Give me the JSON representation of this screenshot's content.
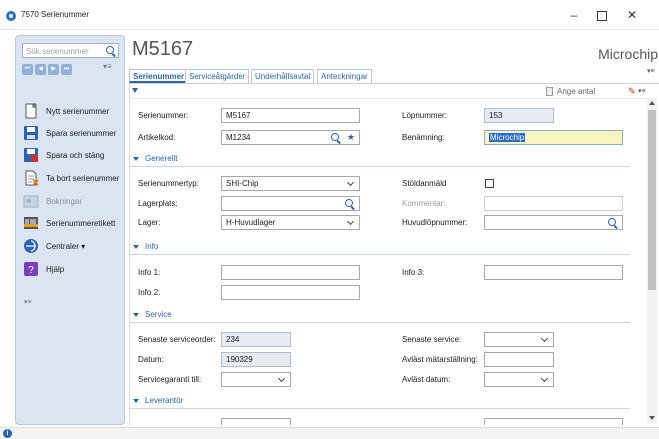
{
  "window": {
    "title": "7570 Serienummer",
    "min_glyph": "–",
    "close_glyph": "✕"
  },
  "sidebar": {
    "search_placeholder": "Sök serienummer",
    "nav_buttons": [
      "⏮",
      "◀",
      "▶",
      "⏭"
    ],
    "menu_glyph": "▾≡",
    "items": [
      {
        "label": "Nytt serienummer",
        "icon": "new-document-icon",
        "enabled": true
      },
      {
        "label": "Spara serienummer",
        "icon": "save-icon",
        "enabled": true
      },
      {
        "label": "Spara och stäng",
        "icon": "save-close-icon",
        "enabled": true
      },
      {
        "label": "Ta bort serienummer",
        "icon": "delete-document-icon",
        "enabled": true
      },
      {
        "label": "Bokningar",
        "icon": "bookings-icon",
        "enabled": false
      },
      {
        "label": "Serienummeretikett",
        "icon": "label-icon",
        "enabled": true
      },
      {
        "label": "Centraler",
        "icon": "centrals-icon",
        "enabled": true,
        "has_dropdown": true,
        "dropdown_glyph": "▾"
      },
      {
        "label": "Hjälp",
        "icon": "help-icon",
        "enabled": true
      }
    ],
    "bottom_menu_glyph": "▾≡"
  },
  "header": {
    "record_id": "M5167",
    "record_name": "Microchip"
  },
  "tabs": [
    {
      "label": "Serienummer",
      "active": true
    },
    {
      "label": "Serviceåtgärder",
      "active": false
    },
    {
      "label": "Underhållsavtal",
      "active": false
    },
    {
      "label": "Anteckningar",
      "active": false
    }
  ],
  "tabs_menu_glyph": "▾≡",
  "toolbar": {
    "ange_antal": "Ange antal",
    "flag_glyph": "✎",
    "menu_glyph": "▾≡"
  },
  "form": {
    "serienummer": {
      "label": "Serienummer:",
      "value": "M5167"
    },
    "lopnummer": {
      "label": "Löpnummer:",
      "value": "153"
    },
    "artikelkod": {
      "label": "Artikelkod:",
      "value": "M1234",
      "star": "★"
    },
    "benamning": {
      "label": "Benämning:",
      "value": "Microchip"
    },
    "sections": {
      "generellt": "Generellt",
      "info": "Info",
      "service": "Service",
      "leverantor": "Leverantör"
    },
    "serienummertyp": {
      "label": "Serienummertyp:",
      "value": "SHI-Chip"
    },
    "stoldanmald": {
      "label": "Stöldanmäld",
      "checked": false
    },
    "lagerplats": {
      "label": "Lagerplats:",
      "value": ""
    },
    "kommentar": {
      "label": "Kommentar:",
      "value": ""
    },
    "lager": {
      "label": "Lager:",
      "value": "H-Huvudlager"
    },
    "huvudlopnummer": {
      "label": "Huvudlöpnummer:",
      "value": ""
    },
    "info1": {
      "label": "Info 1:",
      "value": ""
    },
    "info3": {
      "label": "Info 3:",
      "value": ""
    },
    "info2": {
      "label": "Info 2:",
      "value": ""
    },
    "senaste_serviceorder": {
      "label": "Senaste serviceorder:",
      "value": "234"
    },
    "senaste_service": {
      "label": "Senaste service:",
      "value": ""
    },
    "datum": {
      "label": "Datum:",
      "value": "190329"
    },
    "avlast_matarstallning": {
      "label": "Avläst mätarställning:",
      "value": ""
    },
    "servicegaranti": {
      "label": "Servicegaranti till:",
      "value": ""
    },
    "avlast_datum": {
      "label": "Avläst datum:",
      "value": ""
    }
  },
  "status": {
    "info_glyph": "i"
  },
  "colors": {
    "accent": "#2b63b2",
    "sidebar_bg": "#dbe5f2",
    "readonly_bg": "#e6ebf2",
    "selected_bg": "#f6f5bf"
  }
}
